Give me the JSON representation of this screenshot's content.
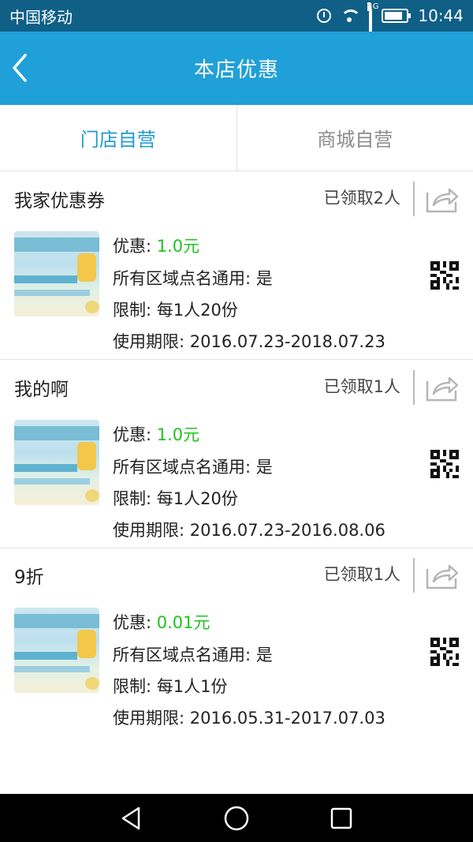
{
  "status_bar": {
    "carrier": "中国移动",
    "network": "4G",
    "time": "10:44",
    "icons": [
      "alarm-clock-icon",
      "wifi-icon",
      "cellular-signal-icon",
      "battery-icon"
    ]
  },
  "header": {
    "title": "本店优惠",
    "back_icon": "chevron-left-icon"
  },
  "tabs": [
    {
      "label": "门店自营",
      "active": true
    },
    {
      "label": "商城自营",
      "active": false
    }
  ],
  "coupons": [
    {
      "name": "我家优惠券",
      "claimed": "已领取2人",
      "discount_label": "优惠:",
      "discount_value": "1.0元",
      "general_label": "所有区域点名通用:",
      "general_value": "是",
      "limit_label": "限制:",
      "limit_value": "每1人20份",
      "period_label": "使用期限:",
      "period_start": "2016.07.23",
      "period_sep": "-",
      "period_end": "2018.07.23"
    },
    {
      "name": "我的啊",
      "claimed": "已领取1人",
      "discount_label": "优惠:",
      "discount_value": "1.0元",
      "general_label": "所有区域点名通用:",
      "general_value": "是",
      "limit_label": "限制:",
      "limit_value": "每1人20份",
      "period_label": "使用期限:",
      "period_start": "2016.07.23",
      "period_sep": "-",
      "period_end": "2016.08.06"
    },
    {
      "name": "9折",
      "claimed": "已领取1人",
      "discount_label": "优惠:",
      "discount_value": "0.01元",
      "general_label": "所有区域点名通用:",
      "general_value": "是",
      "limit_label": "限制:",
      "limit_value": "每1人1份",
      "period_label": "使用期限:",
      "period_start": "2016.05.31",
      "period_sep": "-",
      "period_end": "2017.07.03"
    }
  ],
  "colors": {
    "status_bar": "#0f5f87",
    "header": "#1fa0d8",
    "tab_active": "#1f9bd1",
    "tab_inactive": "#8c8c8c",
    "discount_value": "#1ec31e"
  },
  "nav_bar": {
    "icons": [
      "back-triangle-icon",
      "home-circle-icon",
      "recents-square-icon"
    ]
  }
}
